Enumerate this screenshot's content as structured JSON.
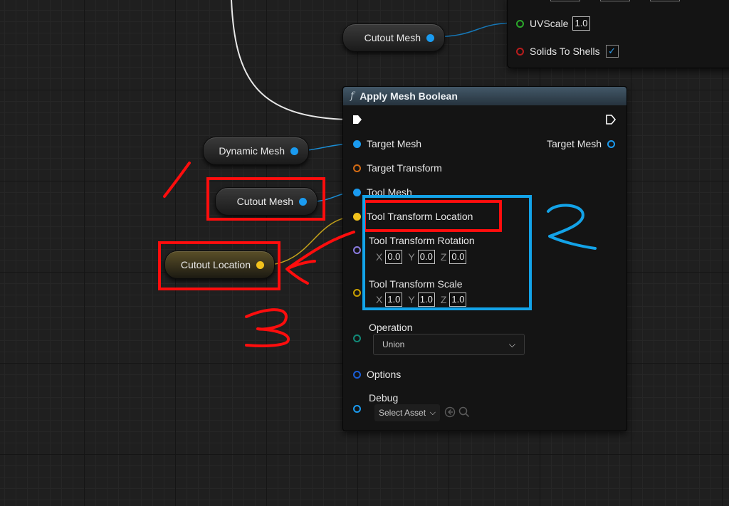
{
  "nodes": {
    "cutout_mesh_top": {
      "label": "Cutout Mesh"
    },
    "dynamic_mesh": {
      "label": "Dynamic Mesh"
    },
    "cutout_mesh_mid": {
      "label": "Cutout Mesh"
    },
    "cutout_location": {
      "label": "Cutout Location"
    }
  },
  "top_panel": {
    "uvscale_label": "UVScale",
    "uvscale_value": "1.0",
    "solids_label": "Solids To Shells",
    "solids_checked": "✓"
  },
  "function_node": {
    "icon": "f",
    "title": "Apply Mesh Boolean",
    "inputs": {
      "target_mesh": "Target Mesh",
      "target_transform": "Target Transform",
      "tool_mesh": "Tool Mesh",
      "tool_location": "Tool Transform Location",
      "tool_rotation": "Tool Transform Rotation",
      "tool_scale": "Tool Transform Scale",
      "operation": "Operation",
      "options": "Options",
      "debug": "Debug"
    },
    "rotation": {
      "x_label": "X",
      "x": "0.0",
      "y_label": "Y",
      "y": "0.0",
      "z_label": "Z",
      "z": "0.0"
    },
    "scale": {
      "x_label": "X",
      "x": "1.0",
      "y_label": "Y",
      "y": "1.0",
      "z_label": "Z",
      "z": "1.0"
    },
    "operation_value": "Union",
    "debug_value": "Select Asset",
    "output_target_mesh": "Target Mesh"
  },
  "annotations": {
    "one": "1",
    "two": "2",
    "three": "3"
  },
  "colors": {
    "annotation_red": "#ff0d0d",
    "annotation_blue": "#13a3e8",
    "pin_blue": "#1a9bf0",
    "pin_yellow": "#f2c21c",
    "header": "#435868"
  }
}
